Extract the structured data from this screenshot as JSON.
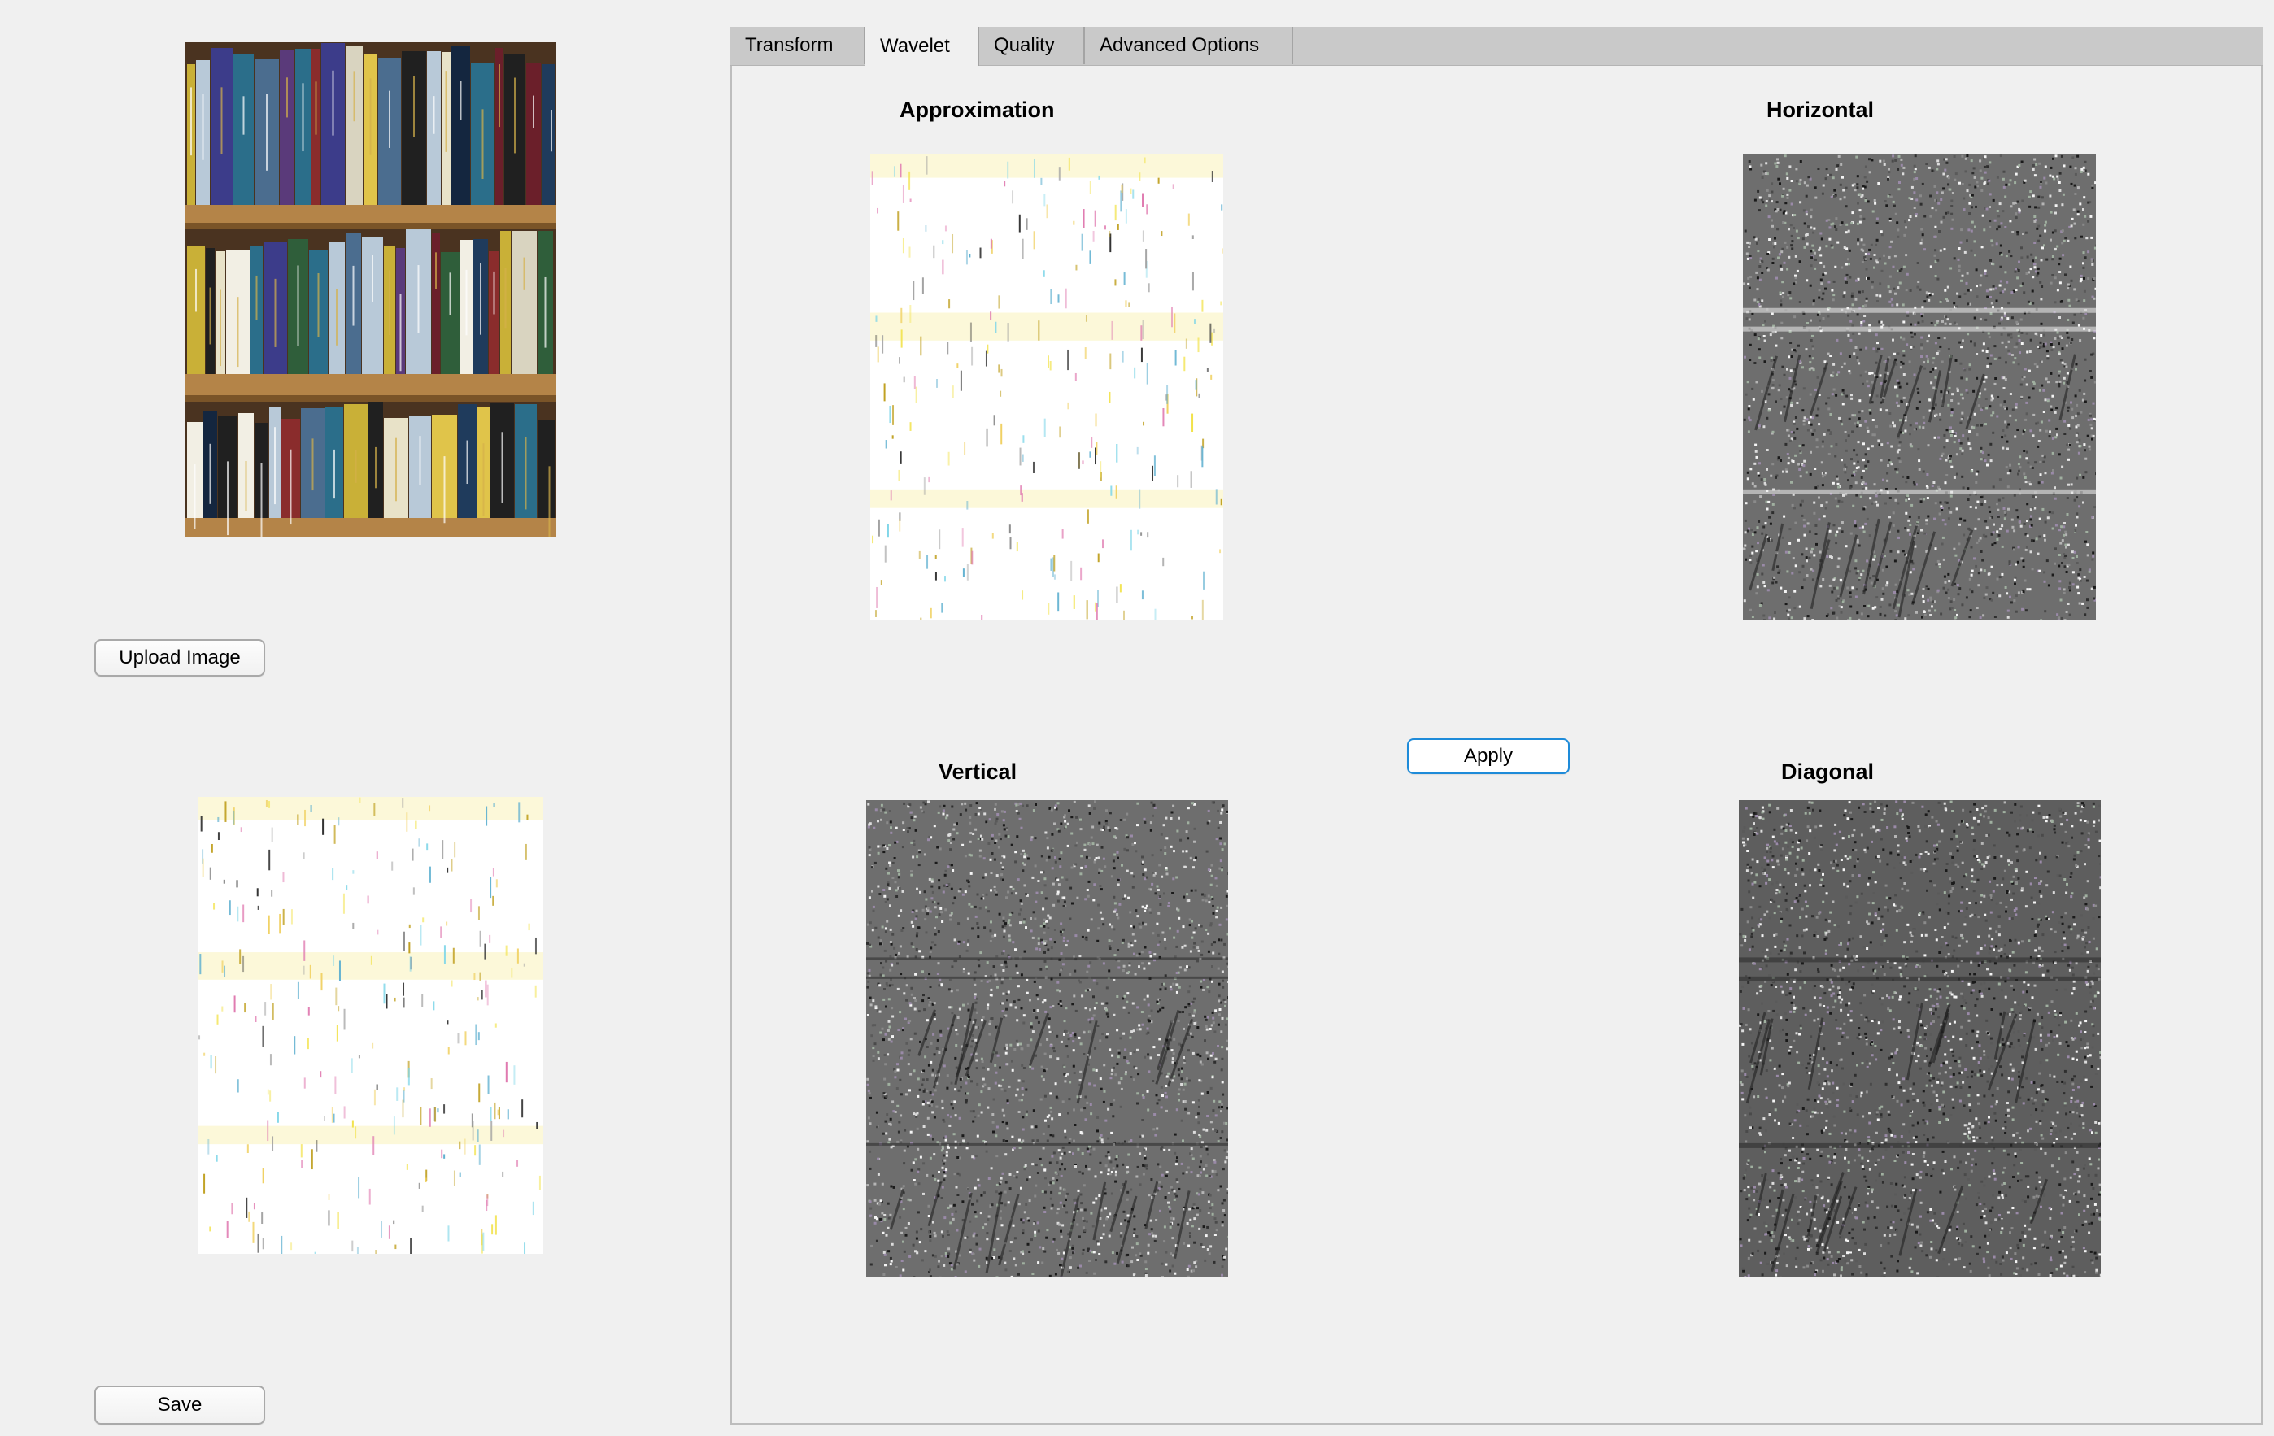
{
  "left": {
    "upload_label": "Upload Image",
    "save_label": "Save"
  },
  "tabs": [
    {
      "label": "Transform",
      "active": false
    },
    {
      "label": "Wavelet",
      "active": true
    },
    {
      "label": "Quality",
      "active": false
    },
    {
      "label": "Advanced Options",
      "active": false
    }
  ],
  "wavelet": {
    "approximation_title": "Approximation",
    "horizontal_title": "Horizontal",
    "vertical_title": "Vertical",
    "diagonal_title": "Diagonal",
    "apply_label": "Apply"
  },
  "colors": {
    "background": "#f0f0f0",
    "tab_strip": "#c9c9c9",
    "apply_border": "#1e8bd9",
    "noise_gray": "#6e6e6e"
  },
  "icons": {}
}
